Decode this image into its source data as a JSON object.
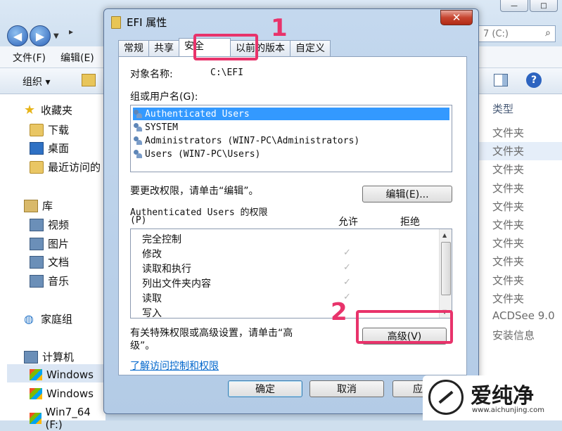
{
  "explorer": {
    "path_prefix": "▸",
    "search_text": "7 (C:)",
    "menu": [
      "文件(F)",
      "编辑(E)"
    ],
    "organize_label": "组织 ▾",
    "nav": {
      "favorites": "收藏夹",
      "downloads": "下载",
      "desktop": "桌面",
      "recent": "最近访问的",
      "libraries": "库",
      "videos": "视频",
      "pictures": "图片",
      "documents": "文档",
      "music": "音乐",
      "homegroup": "家庭组",
      "computer": "计算机",
      "drive1": "Windows",
      "drive2": "Windows",
      "drive3": "Win7_64 (F:)"
    },
    "type_header": "类型",
    "types": [
      "文件夹",
      "文件夹",
      "文件夹",
      "文件夹",
      "文件夹",
      "文件夹",
      "文件夹",
      "文件夹",
      "文件夹",
      "文件夹",
      "ACDSee 9.0",
      "安装信息"
    ]
  },
  "dialog": {
    "title": "EFI 属性",
    "close_label": "✕",
    "tabs": [
      "常规",
      "共享",
      "安全",
      "以前的版本",
      "自定义"
    ],
    "active_tab": "安全",
    "object_label": "对象名称:",
    "object_value": "C:\\EFI",
    "group_label": "组或用户名(G):",
    "users": [
      "Authenticated Users",
      "SYSTEM",
      "Administrators (WIN7-PC\\Administrators)",
      "Users (WIN7-PC\\Users)"
    ],
    "change_text": "要更改权限，请单击“编辑”。",
    "edit_button": "编辑(E)...",
    "perm_title_line1": "Authenticated Users 的权限",
    "perm_title_line2": "(P)",
    "allow_header": "允许",
    "deny_header": "拒绝",
    "permissions": [
      "完全控制",
      "修改",
      "读取和执行",
      "列出文件夹内容",
      "读取",
      "写入"
    ],
    "special_text_line1": "有关特殊权限或高级设置，请单击“高",
    "special_text_line2": "级”。",
    "advanced_button": "高级(V)",
    "learn_link": "了解访问控制和权限",
    "ok_button": "确定",
    "cancel_button": "取消",
    "apply_button": "应"
  },
  "annotations": {
    "step1": "1",
    "step2": "2",
    "accent_color": "#e8336b"
  },
  "watermark": {
    "text": "爱纯净",
    "url": "www.aichunjing.com"
  }
}
